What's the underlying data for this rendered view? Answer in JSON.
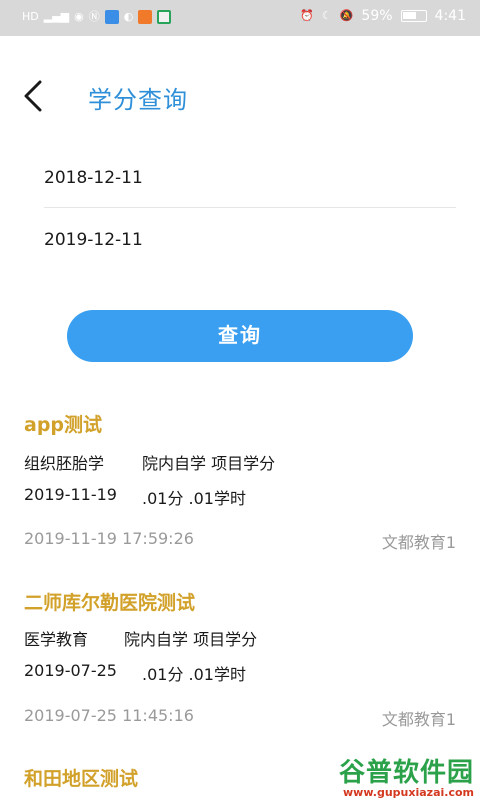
{
  "status_bar": {
    "left_text": "HD",
    "battery": "59%",
    "time": "4:41"
  },
  "header": {
    "title": "学分查询"
  },
  "query": {
    "start_date": "2018-12-11",
    "end_date": "2019-12-11",
    "button_label": "查询"
  },
  "records": [
    {
      "title": "app测试",
      "subject": "组织胚胎学",
      "category": "院内自学 项目学分",
      "date": "2019-11-19",
      "credit": ".01分 .01学时",
      "timestamp": "2019-11-19 17:59:26",
      "org": "文都教育1"
    },
    {
      "title": "二师库尔勒医院测试",
      "subject": "医学教育",
      "category": "院内自学 项目学分",
      "date": "2019-07-25",
      "credit": ".01分 .01学时",
      "timestamp": "2019-07-25 11:45:16",
      "org": "文都教育1"
    },
    {
      "title": "和田地区测试"
    }
  ],
  "watermark": {
    "main": "谷普软件园",
    "url": "www.gupuxiazai.com"
  },
  "colors": {
    "accent": "#2f8fd8",
    "button": "#3a9ff0",
    "record_title": "#d2a12a"
  }
}
